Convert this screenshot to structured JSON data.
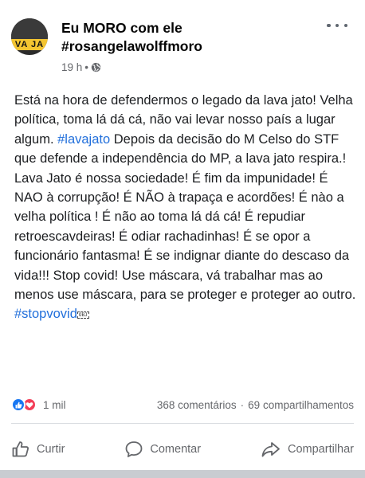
{
  "post": {
    "author_line1": "Eu MORO com ele",
    "author_line2": "#rosangelawolffmoro",
    "avatar_text": "VA JA",
    "timestamp": "19 h",
    "separator": "•",
    "text_part1": "Está na hora de defendermos o legado da lava jato! Velha política, toma lá dá cá, não vai levar nosso país a lugar algum. ",
    "hashtag1": "#lavajato",
    "text_part2": " Depois da decisão do M Celso do STF que defende a independência do MP, a lava jato respira.! Lava Jato é nossa sociedade! É fim da impunidade! É NAO à corrupção! É NÃO à trapaça e acordões! É nào a velha política ! É não ao toma lá dá cá! É repudiar retroescavdeiras! É odiar rachadinhas! É se opor a funcionário fantasma! É se indignar diante do descaso da vida!!! Stop covid! Use máscara, vá trabalhar mas ao menos use máscara, para se proteger e proteger ao outro. ",
    "hashtag2": "#stopvovid",
    "obj_glyph": "OBJ"
  },
  "stats": {
    "reactions": "1 mil",
    "comments": "368 comentários",
    "dot": "·",
    "shares": "69 compartilhamentos"
  },
  "actions": {
    "like": "Curtir",
    "comment": "Comentar",
    "share": "Compartilhar"
  },
  "colors": {
    "hashtag": "#216fdb",
    "like_blue": "#1877f2",
    "love_red": "#f33e58",
    "secondary_text": "#65676b"
  },
  "icons": [
    "globe-icon",
    "more-options-icon",
    "like-reaction-icon",
    "love-reaction-icon",
    "thumbs-up-icon",
    "comment-bubble-icon",
    "share-arrow-icon"
  ]
}
